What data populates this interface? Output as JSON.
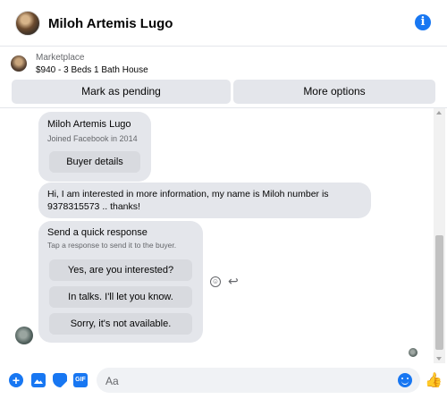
{
  "header": {
    "contact_name": "Miloh Artemis Lugo",
    "info_icon": "info-icon"
  },
  "marketplace": {
    "label": "Marketplace",
    "listing": "$940 - 3 Beds 1 Bath House"
  },
  "actions": {
    "mark_pending": "Mark as pending",
    "more_options": "More options"
  },
  "messages": {
    "profile_card": {
      "name": "Miloh Artemis Lugo",
      "joined": "Joined Facebook in 2014",
      "buyer_details": "Buyer details"
    },
    "buyer_message": "Hi, I am interested in more information,  my name is Miloh number is 9378315573 .. thanks!",
    "quick_response": {
      "title": "Send a quick response",
      "subtitle": "Tap a response to send it to the buyer.",
      "options": [
        "Yes, are you interested?",
        "In talks. I'll let you know.",
        "Sorry, it's not available."
      ]
    }
  },
  "composer": {
    "placeholder": "Aa",
    "gif_label": "GIF",
    "accent_color": "#1877f2"
  }
}
